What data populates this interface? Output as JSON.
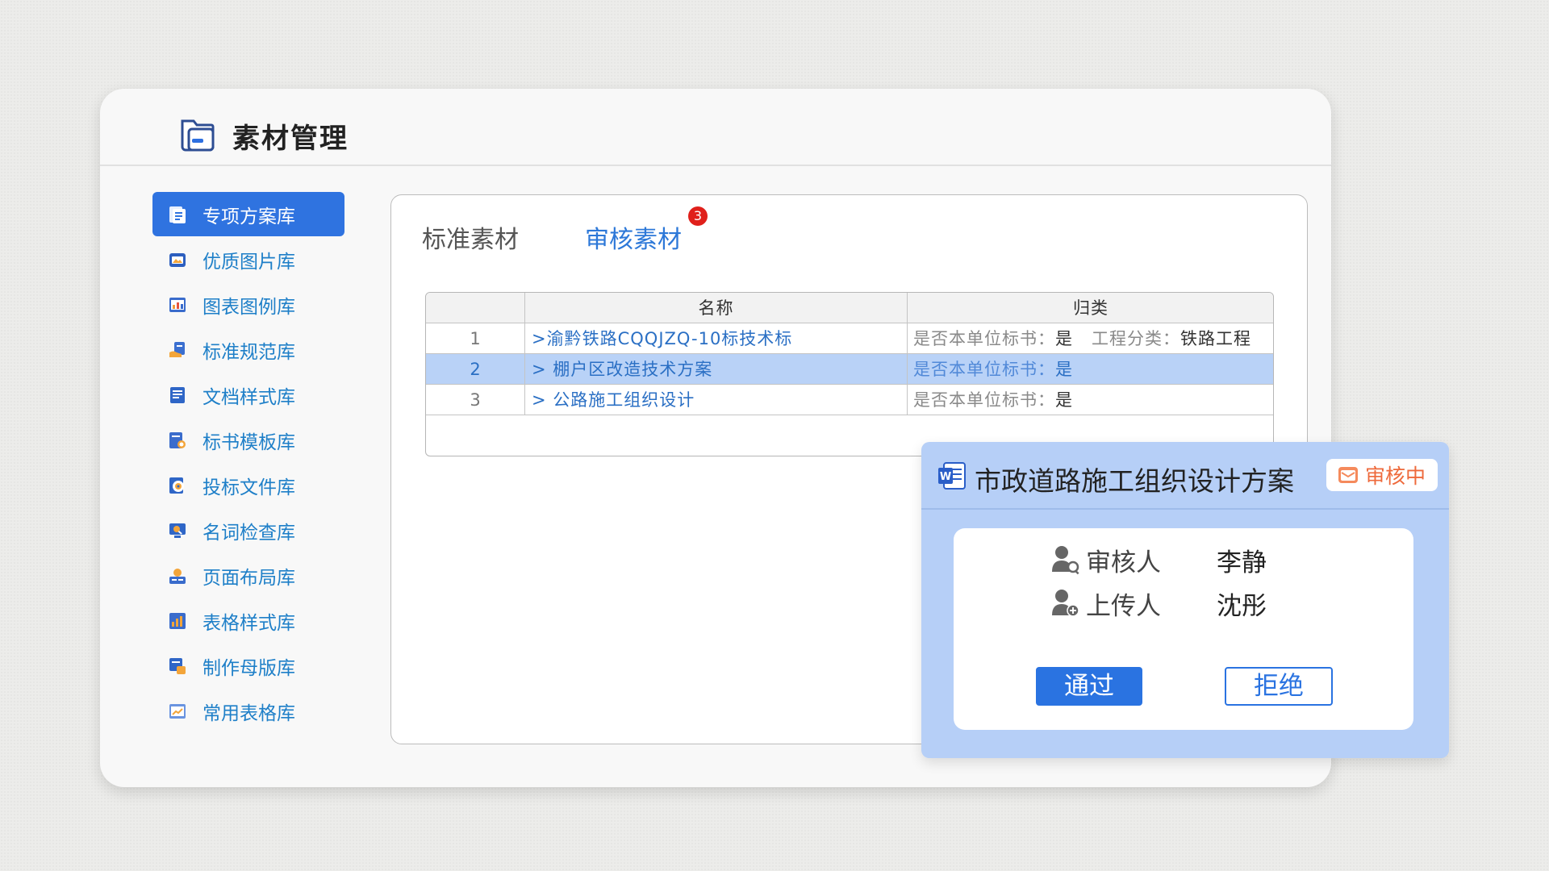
{
  "header": {
    "title": "素材管理",
    "icon": "folder-card-icon"
  },
  "sidebar": {
    "items": [
      {
        "label": "专项方案库",
        "icon": "document-stack-icon",
        "active": true
      },
      {
        "label": "优质图片库",
        "icon": "image-card-icon"
      },
      {
        "label": "图表图例库",
        "icon": "chart-board-icon"
      },
      {
        "label": "标准规范库",
        "icon": "hand-document-icon"
      },
      {
        "label": "文档样式库",
        "icon": "document-list-icon"
      },
      {
        "label": "标书模板库",
        "icon": "template-search-icon"
      },
      {
        "label": "投标文件库",
        "icon": "target-document-icon"
      },
      {
        "label": "名词检查库",
        "icon": "search-monitor-icon"
      },
      {
        "label": "页面布局库",
        "icon": "layout-sun-icon"
      },
      {
        "label": "表格样式库",
        "icon": "bar-chart-icon"
      },
      {
        "label": "制作母版库",
        "icon": "master-template-icon"
      },
      {
        "label": "常用表格库",
        "icon": "table-chart-icon"
      }
    ]
  },
  "tabs": {
    "standard": "标准素材",
    "review": "审核素材",
    "review_badge": "3"
  },
  "table": {
    "columns": {
      "name": "名称",
      "category": "归类"
    },
    "rows": [
      {
        "index": "1",
        "name": ">渝黔铁路CQQJZQ-10标技术标",
        "cat_label1": "是否本单位标书：",
        "cat_value1": "是",
        "cat_label2": "工程分类：",
        "cat_value2": "铁路工程"
      },
      {
        "index": "2",
        "name": "> 棚户区改造技术方案",
        "cat_label1": "是否本单位标书：",
        "cat_value1": "是"
      },
      {
        "index": "3",
        "name": "> 公路施工组织设计",
        "cat_label1": "是否本单位标书：",
        "cat_value1": "是"
      }
    ]
  },
  "review_card": {
    "file_icon": "word-document-icon",
    "title": "市政道路施工组织设计方案",
    "status": "审核中",
    "status_color": "#ee6a3c",
    "reviewer_label": "审核人",
    "reviewer": "李静",
    "uploader_label": "上传人",
    "uploader": "沈彤",
    "approve_label": "通过",
    "reject_label": "拒绝"
  },
  "colors": {
    "accent": "#2f73e0",
    "badge": "#e0201b",
    "card_bg": "#b6cff7"
  }
}
